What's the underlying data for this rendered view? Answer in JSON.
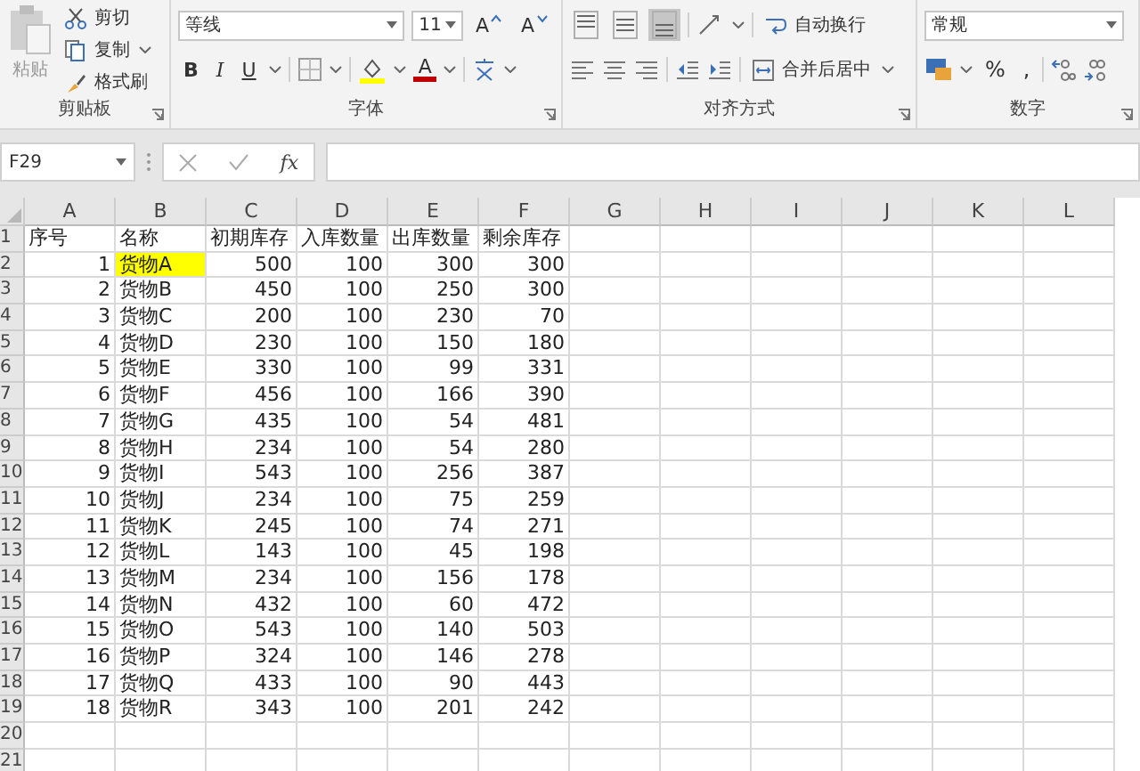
{
  "ribbon": {
    "clipboard": {
      "paste": "粘贴",
      "cut": "剪切",
      "copy": "复制",
      "format_painter": "格式刷",
      "label": "剪贴板"
    },
    "font": {
      "font_name": "等线",
      "font_size": "11",
      "size_buttons": [
        {
          "label": "A",
          "kind": "grow"
        },
        {
          "label": "A",
          "kind": "shrink"
        }
      ],
      "style_buttons": [
        {
          "label": "B",
          "kind": "bold"
        },
        {
          "label": "I",
          "kind": "italic"
        },
        {
          "label": "U",
          "kind": "underline"
        }
      ],
      "font_color": "A",
      "label": "字体"
    },
    "alignment": {
      "vertical": [
        {
          "kind": "top",
          "selected": false
        },
        {
          "kind": "middle",
          "selected": false
        },
        {
          "kind": "bottom",
          "selected": true
        }
      ],
      "wrap_text": "自动换行",
      "merge_center": "合并后居中",
      "label": "对齐方式"
    },
    "number": {
      "format": "常规",
      "percent": "%",
      "comma": ",",
      "label": "数字"
    }
  },
  "formula_bar": {
    "name_box": "F29",
    "fx": "fx"
  },
  "sheet": {
    "columns": [
      "A",
      "B",
      "C",
      "D",
      "E",
      "F",
      "G",
      "H",
      "I",
      "J",
      "K",
      "L"
    ],
    "rows": [
      {
        "header": "1",
        "cells": [
          "序号",
          "名称",
          "初期库存",
          "入库数量",
          "出库数量",
          "剩余库存"
        ],
        "highlighted": false
      },
      {
        "header": "2",
        "cells": [
          "1",
          "货物A",
          "500",
          "100",
          "300",
          "300"
        ],
        "highlighted": true
      },
      {
        "header": "3",
        "cells": [
          "2",
          "货物B",
          "450",
          "100",
          "250",
          "300"
        ],
        "highlighted": false
      },
      {
        "header": "4",
        "cells": [
          "3",
          "货物C",
          "200",
          "100",
          "230",
          "70"
        ],
        "highlighted": false
      },
      {
        "header": "5",
        "cells": [
          "4",
          "货物D",
          "230",
          "100",
          "150",
          "180"
        ],
        "highlighted": false
      },
      {
        "header": "6",
        "cells": [
          "5",
          "货物E",
          "330",
          "100",
          "99",
          "331"
        ],
        "highlighted": false
      },
      {
        "header": "7",
        "cells": [
          "6",
          "货物F",
          "456",
          "100",
          "166",
          "390"
        ],
        "highlighted": false
      },
      {
        "header": "8",
        "cells": [
          "7",
          "货物G",
          "435",
          "100",
          "54",
          "481"
        ],
        "highlighted": false
      },
      {
        "header": "9",
        "cells": [
          "8",
          "货物H",
          "234",
          "100",
          "54",
          "280"
        ],
        "highlighted": false
      },
      {
        "header": "10",
        "cells": [
          "9",
          "货物I",
          "543",
          "100",
          "256",
          "387"
        ],
        "highlighted": false
      },
      {
        "header": "11",
        "cells": [
          "10",
          "货物J",
          "234",
          "100",
          "75",
          "259"
        ],
        "highlighted": false
      },
      {
        "header": "12",
        "cells": [
          "11",
          "货物K",
          "245",
          "100",
          "74",
          "271"
        ],
        "highlighted": false
      },
      {
        "header": "13",
        "cells": [
          "12",
          "货物L",
          "143",
          "100",
          "45",
          "198"
        ],
        "highlighted": false
      },
      {
        "header": "14",
        "cells": [
          "13",
          "货物M",
          "234",
          "100",
          "156",
          "178"
        ],
        "highlighted": false
      },
      {
        "header": "15",
        "cells": [
          "14",
          "货物N",
          "432",
          "100",
          "60",
          "472"
        ],
        "highlighted": false
      },
      {
        "header": "16",
        "cells": [
          "15",
          "货物O",
          "543",
          "100",
          "140",
          "503"
        ],
        "highlighted": false
      },
      {
        "header": "17",
        "cells": [
          "16",
          "货物P",
          "324",
          "100",
          "146",
          "278"
        ],
        "highlighted": false
      },
      {
        "header": "18",
        "cells": [
          "17",
          "货物Q",
          "433",
          "100",
          "90",
          "443"
        ],
        "highlighted": false
      },
      {
        "header": "19",
        "cells": [
          "18",
          "货物R",
          "343",
          "100",
          "201",
          "242"
        ],
        "highlighted": false
      },
      {
        "header": "20",
        "highlighted": false
      },
      {
        "header": "21",
        "highlighted": false
      }
    ]
  }
}
